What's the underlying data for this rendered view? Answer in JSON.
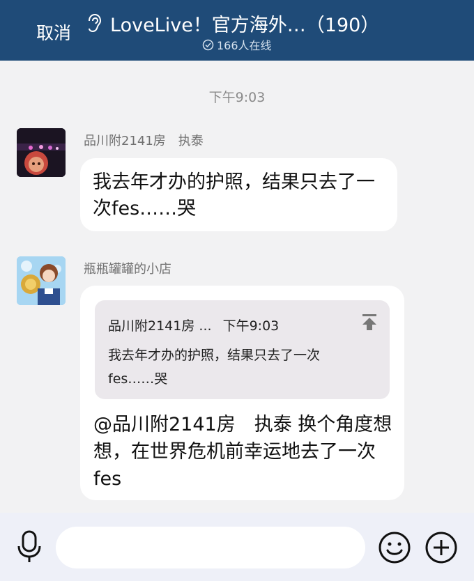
{
  "header": {
    "cancel_label": "取消",
    "title": "LoveLive！官方海外…（190）",
    "online_text": "166人在线",
    "background_color": "#1f4b78"
  },
  "chat": {
    "timestamp": "下午9:03",
    "messages": [
      {
        "sender": "品川附2141房　执泰",
        "avatar_icon": "concert-stage-avatar",
        "text": "我去年才办的护照，结果只去了一次fes……哭"
      },
      {
        "sender": "瓶瓶罐罐的小店",
        "avatar_icon": "anime-girl-tuba-avatar",
        "quote": {
          "author": "品川附2141房",
          "ellipsis": "...",
          "time": "下午9:03",
          "text": "我去年才办的护照，结果只去了一次fes……哭"
        },
        "text": "@品川附2141房　执泰 换个角度想想，在世界危机前幸运地去了一次fes"
      }
    ]
  },
  "input_bar": {
    "placeholder": "",
    "icons": [
      "microphone-icon",
      "emoji-icon",
      "plus-icon"
    ]
  }
}
